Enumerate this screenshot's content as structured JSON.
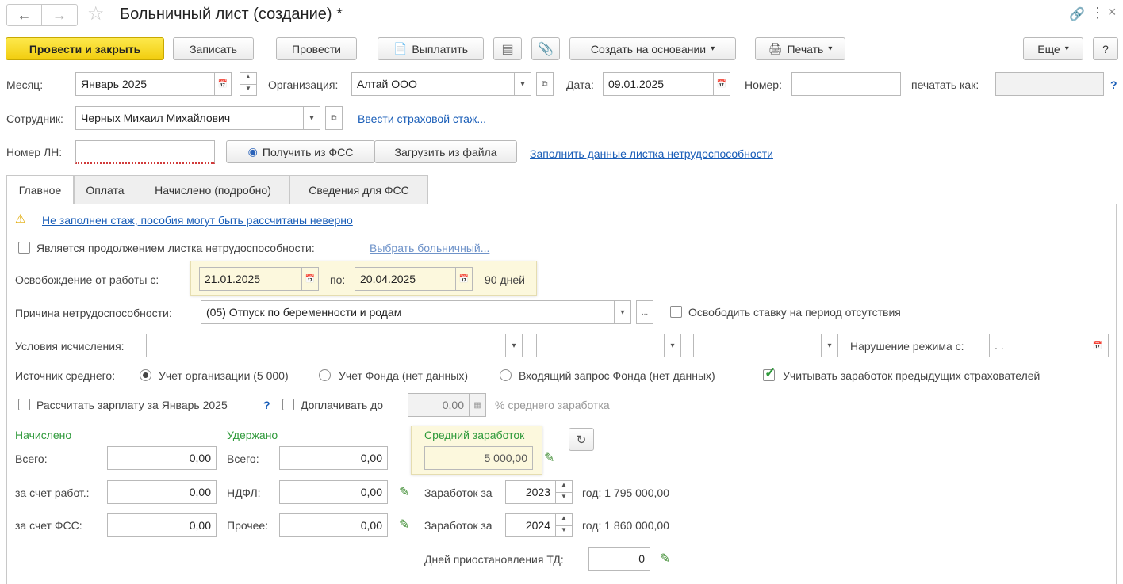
{
  "header": {
    "title": "Больничный лист (создание) *",
    "close": "×",
    "more": "⋮"
  },
  "toolbar": {
    "post_close": "Провести и закрыть",
    "save": "Записать",
    "post": "Провести",
    "pay": "Выплатить",
    "create_based": "Создать на основании",
    "print": "Печать",
    "more": "Еще",
    "help": "?"
  },
  "top_fields": {
    "month_label": "Месяц:",
    "month_value": "Январь 2025",
    "org_label": "Организация:",
    "org_value": "Алтай ООО",
    "date_label": "Дата:",
    "date_value": "09.01.2025",
    "number_label": "Номер:",
    "number_value": "",
    "print_as_label": "печатать как:",
    "print_as_value": "",
    "help": "?",
    "employee_label": "Сотрудник:",
    "employee_value": "Черных Михаил Михайлович",
    "insurance_link": "Ввести страховой стаж...",
    "ln_label": "Номер ЛН:",
    "ln_value": "",
    "get_fss": "Получить из ФСС",
    "load_file": "Загрузить из файла",
    "fill_link": "Заполнить данные листка нетрудоспособности"
  },
  "tabs": [
    "Главное",
    "Оплата",
    "Начислено (подробно)",
    "Сведения для ФСС"
  ],
  "main": {
    "warning_link": "Не заполнен стаж, пособия могут быть рассчитаны неверно",
    "continuation_label": "Является продолжением листка нетрудоспособности:",
    "choose_sick_link": "Выбрать больничный...",
    "release_label": "Освобождение от работы с:",
    "release_from": "21.01.2025",
    "release_to_label": "по:",
    "release_to": "20.04.2025",
    "days": "90 дней",
    "reason_label": "Причина нетрудоспособности:",
    "reason_value": "(05) Отпуск по беременности и родам",
    "free_rate_label": "Освободить ставку на период отсутствия",
    "conditions_label": "Условия исчисления:",
    "violation_label": "Нарушение режима с:",
    "violation_value": " .  .",
    "source_label": "Источник среднего:",
    "source_org": "Учет организации (5 000)",
    "source_fund": "Учет Фонда (нет данных)",
    "source_request": "Входящий запрос Фонда (нет данных)",
    "prev_insurers": "Учитывать заработок предыдущих страхователей",
    "calc_salary": "Рассчитать зарплату за Январь 2025",
    "calc_help": "?",
    "topup_label": "Доплачивать до",
    "topup_value": "0,00",
    "topup_suffix": "% среднего заработка",
    "accrued_title": "Начислено",
    "accrued_total_label": "Всего:",
    "accrued_total": "0,00",
    "accrued_employer_label": "за счет работ.:",
    "accrued_employer": "0,00",
    "accrued_fss_label": "за счет ФСС:",
    "accrued_fss": "0,00",
    "withheld_title": "Удержано",
    "withheld_total_label": "Всего:",
    "withheld_total": "0,00",
    "withheld_ndfl_label": "НДФЛ:",
    "withheld_ndfl": "0,00",
    "withheld_other_label": "Прочее:",
    "withheld_other": "0,00",
    "avg_title": "Средний заработок",
    "avg_value": "5 000,00",
    "earn_label": "Заработок за",
    "year1": "2023",
    "year1_label": "год: 1 795 000,00",
    "year2": "2024",
    "year2_label": "год: 1 860 000,00",
    "suspension_label": "Дней приостановления ТД:",
    "suspension_value": "0"
  }
}
